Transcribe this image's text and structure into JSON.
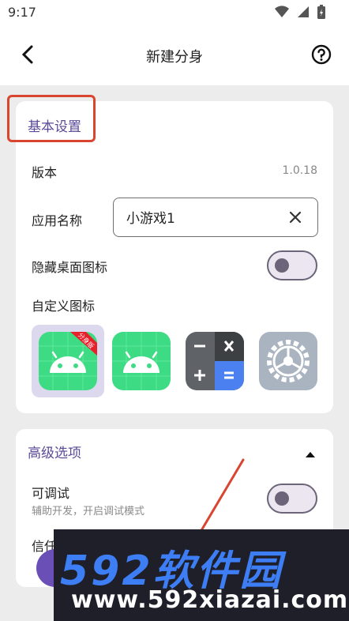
{
  "status_bar": {
    "time": "9:17"
  },
  "app_bar": {
    "title": "新建分身"
  },
  "basic": {
    "section_title": "基本设置",
    "version_label": "版本",
    "version_value": "1.0.18",
    "app_name_label": "应用名称",
    "app_name_value": "小游戏1",
    "hide_icon_label": "隐藏桌面图标",
    "hide_icon_on": false,
    "custom_icon_label": "自定义图标",
    "icons": [
      {
        "name": "android-clone-icon",
        "badge": "分身版",
        "selected": true
      },
      {
        "name": "android-icon",
        "selected": false
      },
      {
        "name": "calculator-icon",
        "selected": false
      },
      {
        "name": "settings-gear-icon",
        "selected": false
      }
    ]
  },
  "advanced": {
    "section_title": "高级选项",
    "debuggable_label": "可调试",
    "debuggable_sub": "辅助开发，开启调试模式",
    "debuggable_on": false,
    "trust_label_partial": "信任"
  },
  "watermark": {
    "logo": "592软件园",
    "site": "www.592xiazai.com"
  },
  "colors": {
    "accent": "#5b4a98",
    "highlight": "#d9452f",
    "annotation_line": "#d9452f"
  }
}
